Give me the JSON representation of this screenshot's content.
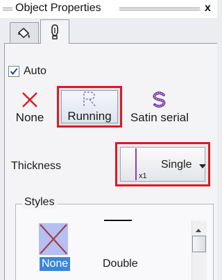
{
  "window": {
    "title": "Object Properties",
    "close_glyph": "x"
  },
  "tabs": [
    {
      "icon": "fill-bucket-icon",
      "active": false
    },
    {
      "icon": "pen-nib-icon",
      "active": true
    }
  ],
  "auto": {
    "label": "Auto",
    "checked": true
  },
  "stitch_types": [
    {
      "label": "None",
      "icon": "x-mark-icon",
      "selected": false
    },
    {
      "label": "Running",
      "icon": "running-stitch-icon",
      "selected": true
    },
    {
      "label": "Satin serial",
      "icon": "satin-serial-icon",
      "selected": false
    }
  ],
  "thickness": {
    "label": "Thickness",
    "value": "Single",
    "multiplier": "x1"
  },
  "styles": {
    "legend": "Styles",
    "items": [
      {
        "label": "None",
        "selected": true
      },
      {
        "label": "Double",
        "selected": false
      }
    ]
  },
  "colors": {
    "highlight_red": "#e01820",
    "selection_blue": "#3a86d8",
    "x_mark_red": "#e01820",
    "running_icon_purple": "#8a7ad6",
    "satin_icon_purple": "#7a3fae"
  }
}
